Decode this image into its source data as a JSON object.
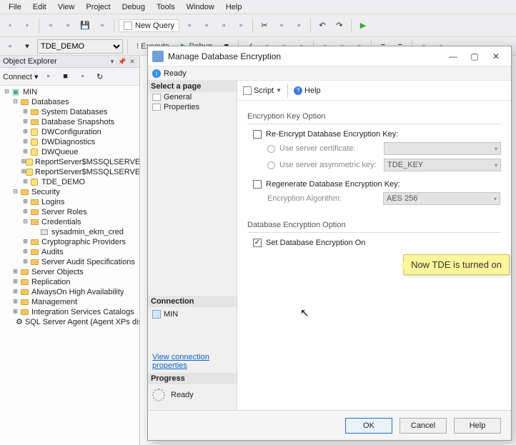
{
  "menubar": [
    "File",
    "Edit",
    "View",
    "Project",
    "Debug",
    "Tools",
    "Window",
    "Help"
  ],
  "toolbar": {
    "new_query": "New Query",
    "db_selected": "TDE_DEMO",
    "execute": "Execute",
    "debug": "Debug"
  },
  "object_explorer": {
    "title": "Object Explorer",
    "connect_label": "Connect ▾",
    "server": "MIN",
    "nodes": {
      "databases": "Databases",
      "system_databases": "System Databases",
      "db_snapshots": "Database Snapshots",
      "dwconfig": "DWConfiguration",
      "dwdiag": "DWDiagnostics",
      "dwqueue": "DWQueue",
      "rs1": "ReportServer$MSSQLSERVER",
      "rs2": "ReportServer$MSSQLSERVER",
      "tde_demo": "TDE_DEMO",
      "security": "Security",
      "logins": "Logins",
      "server_roles": "Server Roles",
      "credentials": "Credentials",
      "cred_item": "sysadmin_ekm_cred",
      "crypto": "Cryptographic Providers",
      "audits": "Audits",
      "audit_specs": "Server Audit Specifications",
      "server_objects": "Server Objects",
      "replication": "Replication",
      "alwayson": "AlwaysOn High Availability",
      "management": "Management",
      "isc": "Integration Services Catalogs",
      "agent": "SQL Server Agent (Agent XPs disabl"
    }
  },
  "dialog": {
    "title": "Manage Database Encryption",
    "ready": "Ready",
    "select_page": "Select a page",
    "pages": {
      "general": "General",
      "properties": "Properties"
    },
    "connection_hdr": "Connection",
    "connection_server": "MIN",
    "view_conn_props": "View connection properties",
    "progress_hdr": "Progress",
    "progress_state": "Ready",
    "toolbar": {
      "script": "Script",
      "help": "Help"
    },
    "enc_key_opt": "Encryption Key Option",
    "reencrypt": "Re-Encrypt Database Encryption Key:",
    "use_server_cert": "Use server certificate:",
    "use_asym_key": "Use server asymmetric key:",
    "asym_key_value": "TDE_KEY",
    "regenerate": "Regenerate Database Encryption Key:",
    "enc_algo": "Encryption Algorithm:",
    "algo_value": "AES 256",
    "db_enc_opt": "Database Encryption Option",
    "set_db_enc_on": "Set Database Encryption On",
    "callout": "Now TDE is turned on",
    "buttons": {
      "ok": "OK",
      "cancel": "Cancel",
      "help": "Help"
    }
  }
}
